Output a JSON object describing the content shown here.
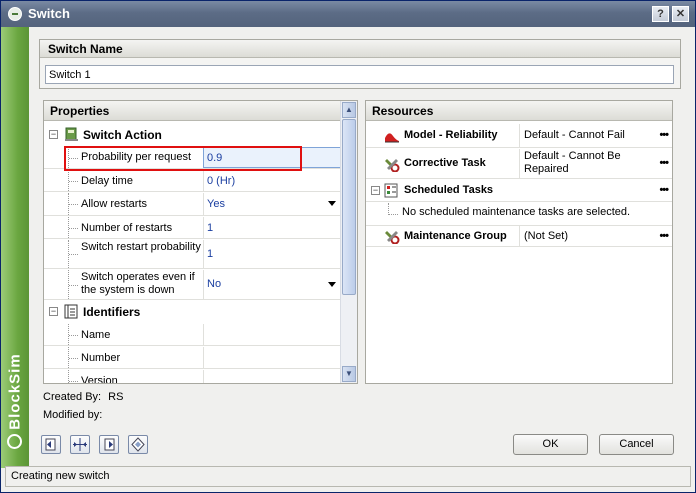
{
  "window": {
    "title": "Switch",
    "help_label": "?",
    "close_label": "✕"
  },
  "sidebar": {
    "brand": "BlockSim"
  },
  "switch_name": {
    "heading": "Switch Name",
    "value": "Switch 1"
  },
  "properties": {
    "heading": "Properties",
    "categories": [
      {
        "label": "Switch Action",
        "toggle": "−"
      },
      {
        "label": "Identifiers",
        "toggle": "−"
      }
    ],
    "rows": [
      {
        "label": "Probability per request",
        "value": "0.9"
      },
      {
        "label": "Delay time",
        "value": "0 (Hr)"
      },
      {
        "label": "Allow restarts",
        "value": "Yes"
      },
      {
        "label": "Number of restarts",
        "value": "1"
      },
      {
        "label": "Switch restart probability",
        "value": "1"
      },
      {
        "label": "Switch operates even if the system is down",
        "value": "No"
      },
      {
        "label": "Name",
        "value": ""
      },
      {
        "label": "Number",
        "value": ""
      },
      {
        "label": "Version",
        "value": ""
      }
    ]
  },
  "resources": {
    "heading": "Resources",
    "rows": [
      {
        "label": "Model - Reliability",
        "value": "Default - Cannot Fail",
        "dots": "•••"
      },
      {
        "label": "Corrective Task",
        "value": "Default - Cannot Be Repaired",
        "dots": "•••"
      },
      {
        "label": "Scheduled Tasks",
        "value": "",
        "dots": "•••",
        "toggle": "−"
      },
      {
        "label": "Maintenance Group",
        "value": "(Not Set)",
        "dots": "•••"
      }
    ],
    "note": "No scheduled maintenance tasks are selected."
  },
  "footer": {
    "created_by_label": "Created By:",
    "created_by_value": "RS",
    "modified_by_label": "Modified by:",
    "modified_by_value": ""
  },
  "buttons": {
    "ok": "OK",
    "cancel": "Cancel"
  },
  "status": "Creating new switch"
}
